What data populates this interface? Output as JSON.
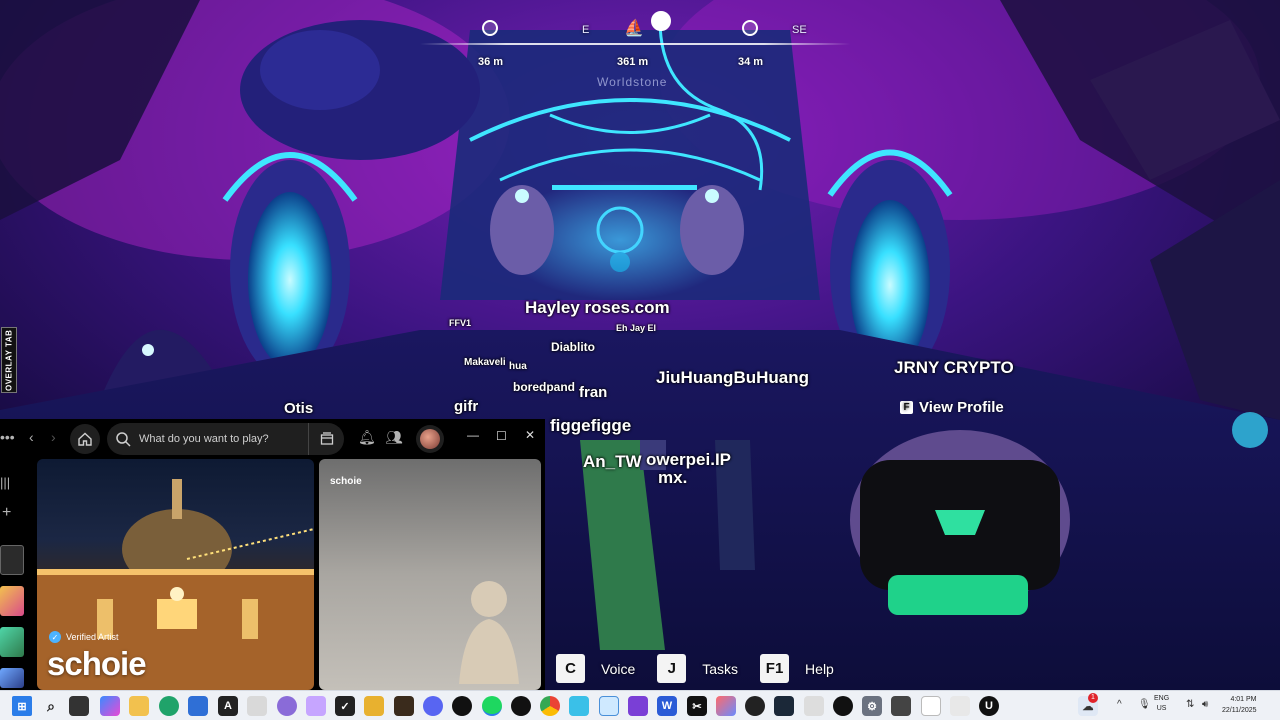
{
  "hud": {
    "compass": {
      "headings": [
        {
          "label": "E"
        },
        {
          "label": "SE"
        }
      ],
      "distances": [
        "36 m",
        "361 m",
        "34 m"
      ],
      "waypoint": "Worldstone"
    },
    "overlay_tab": "OVERLAY TAB"
  },
  "players": {
    "hayley": "Hayley roses.com",
    "eh_jay": "Eh Jay El",
    "ffv1": "FFV1",
    "diablito": "Diablito",
    "makaveli": "Makaveli",
    "hua": "hua",
    "boredpanda": "boredpand",
    "fran": "fran",
    "jiuhuang": "JiuHuangBuHuang",
    "jrny": "JRNY CRYPTO",
    "otis": "Otis",
    "gifr": "gifr",
    "figgefigge": "figgefigge",
    "an_tw": "An_TW",
    "powerpei": "owerpei.IP",
    "mx": "mx."
  },
  "view_profile": {
    "key": "F",
    "label": "View Profile"
  },
  "hotkeys": [
    {
      "key": "C",
      "label": "Voice"
    },
    {
      "key": "J",
      "label": "Tasks"
    },
    {
      "key": "F1",
      "label": "Help"
    }
  ],
  "spotify": {
    "search_placeholder": "What do you want to play?",
    "verified_label": "Verified Artist",
    "artist_name": "schoie",
    "panel_title": "schoie"
  },
  "taskbar": {
    "lang_top": "ENG",
    "lang_bottom": "US",
    "time": "4:01 PM",
    "date": "22/11/2025",
    "notification_count": "1"
  },
  "colors": {
    "accent_cyan": "#3fe6ff",
    "portal_purple": "#5b1fa8",
    "spotify_green": "#1ed760"
  }
}
